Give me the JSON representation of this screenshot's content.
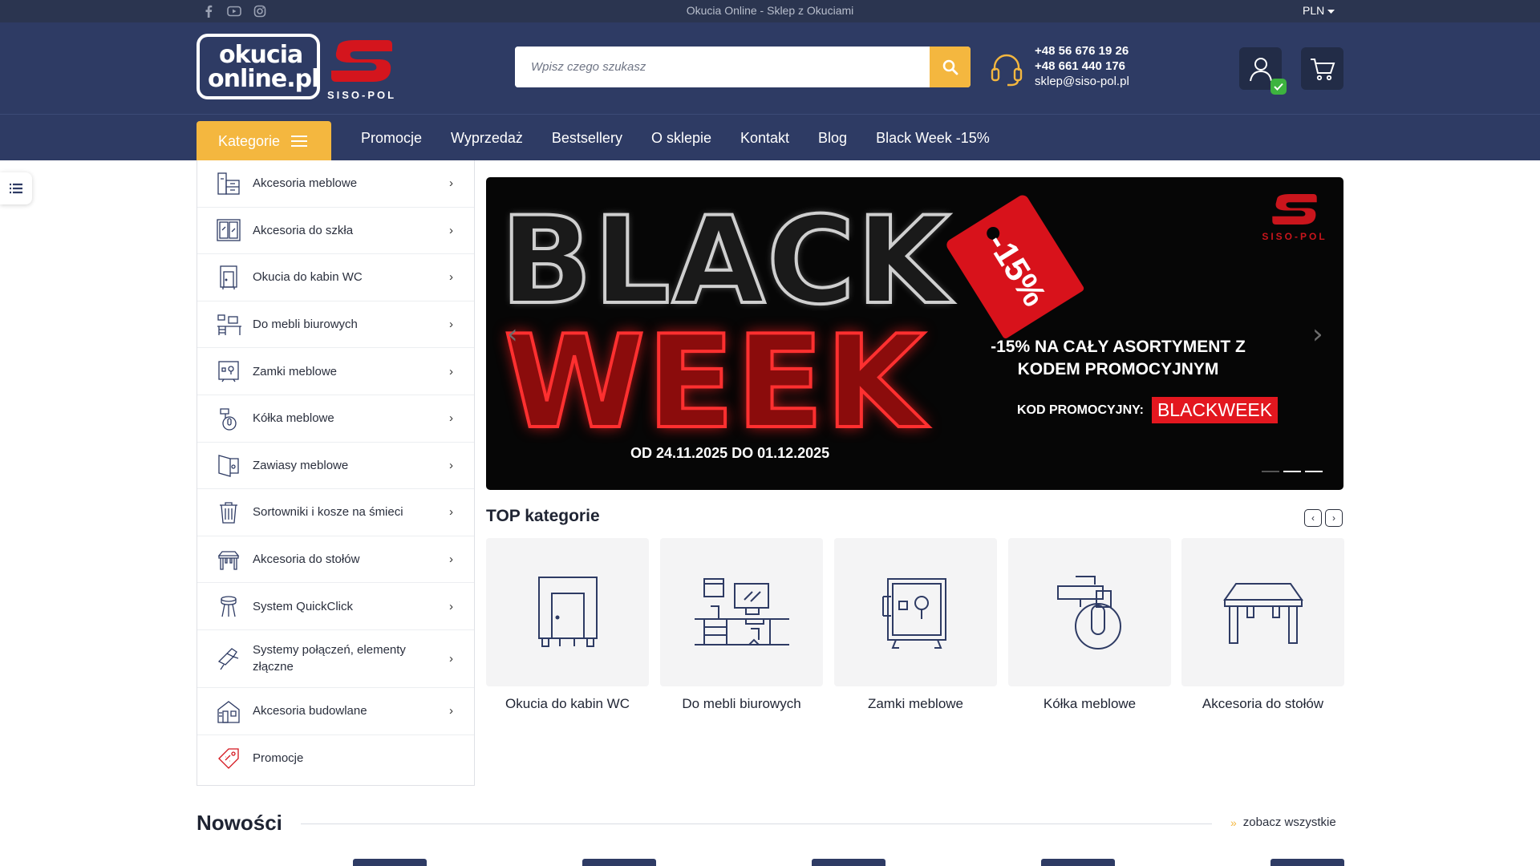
{
  "topbar": {
    "title": "Okucia Online - Sklep z Okuciami",
    "currency": "PLN",
    "social_icons": [
      "facebook-icon",
      "youtube-icon",
      "instagram-icon"
    ]
  },
  "header": {
    "logo_line1": "okucia",
    "logo_line2": "online.pl",
    "brand_text": "SISO-POL",
    "search_placeholder": "Wpisz czego szukasz",
    "phone1": "+48 56 676 19 26",
    "phone2": "+48 661 440 176",
    "email": "sklep@siso-pol.pl"
  },
  "nav": {
    "categories_button": "Kategorie",
    "links": [
      "Promocje",
      "Wyprzedaż",
      "Bestsellery",
      "O sklepie",
      "Kontakt",
      "Blog",
      "Black Week -15%"
    ]
  },
  "categories": [
    {
      "label": "Akcesoria meblowe",
      "icon": "furniture-accessories-icon"
    },
    {
      "label": "Akcesoria do szkła",
      "icon": "glass-accessories-icon"
    },
    {
      "label": "Okucia do kabin WC",
      "icon": "wc-cabin-icon"
    },
    {
      "label": "Do mebli biurowych",
      "icon": "office-furniture-icon"
    },
    {
      "label": "Zamki meblowe",
      "icon": "furniture-lock-icon"
    },
    {
      "label": "Kółka meblowe",
      "icon": "furniture-wheel-icon"
    },
    {
      "label": "Zawiasy meblowe",
      "icon": "hinge-icon"
    },
    {
      "label": "Sortowniki i kosze na śmieci",
      "icon": "bin-icon"
    },
    {
      "label": "Akcesoria do stołów",
      "icon": "table-icon"
    },
    {
      "label": "System QuickClick",
      "icon": "quickclick-icon"
    },
    {
      "label": "Systemy połączeń, elementy złączne",
      "icon": "connector-icon"
    },
    {
      "label": "Akcesoria budowlane",
      "icon": "building-icon"
    },
    {
      "label": "Promocje",
      "icon": "promo-tag-icon"
    }
  ],
  "banner": {
    "word1": "BLACK",
    "word2": "WEEK",
    "discount_tag": "-15%",
    "headline": "-15% NA CAŁY ASORTYMENT Z KODEM PROMOCYJNYM",
    "code_label": "KOD PROMOCYJNY:",
    "code": "BLACKWEEK",
    "dates": "OD 24.11.2025 DO 01.12.2025",
    "brand": "SISO-POL",
    "slides_total": 3,
    "active_slide": 2
  },
  "top_categories": {
    "title": "TOP kategorie",
    "items": [
      {
        "label": "Okucia do kabin WC",
        "icon": "wc-cabin-icon"
      },
      {
        "label": "Do mebli biurowych",
        "icon": "office-furniture-icon"
      },
      {
        "label": "Zamki meblowe",
        "icon": "furniture-lock-icon"
      },
      {
        "label": "Kółka meblowe",
        "icon": "furniture-wheel-icon"
      },
      {
        "label": "Akcesoria do stołów",
        "icon": "table-icon"
      }
    ]
  },
  "new_section": {
    "title": "Nowości",
    "see_all": "zobacz wszystkie"
  },
  "colors": {
    "header_bg": "#2e3b64",
    "topbar_bg": "#2b3550",
    "accent": "#f4b73f",
    "promo_red": "#e3171f"
  }
}
